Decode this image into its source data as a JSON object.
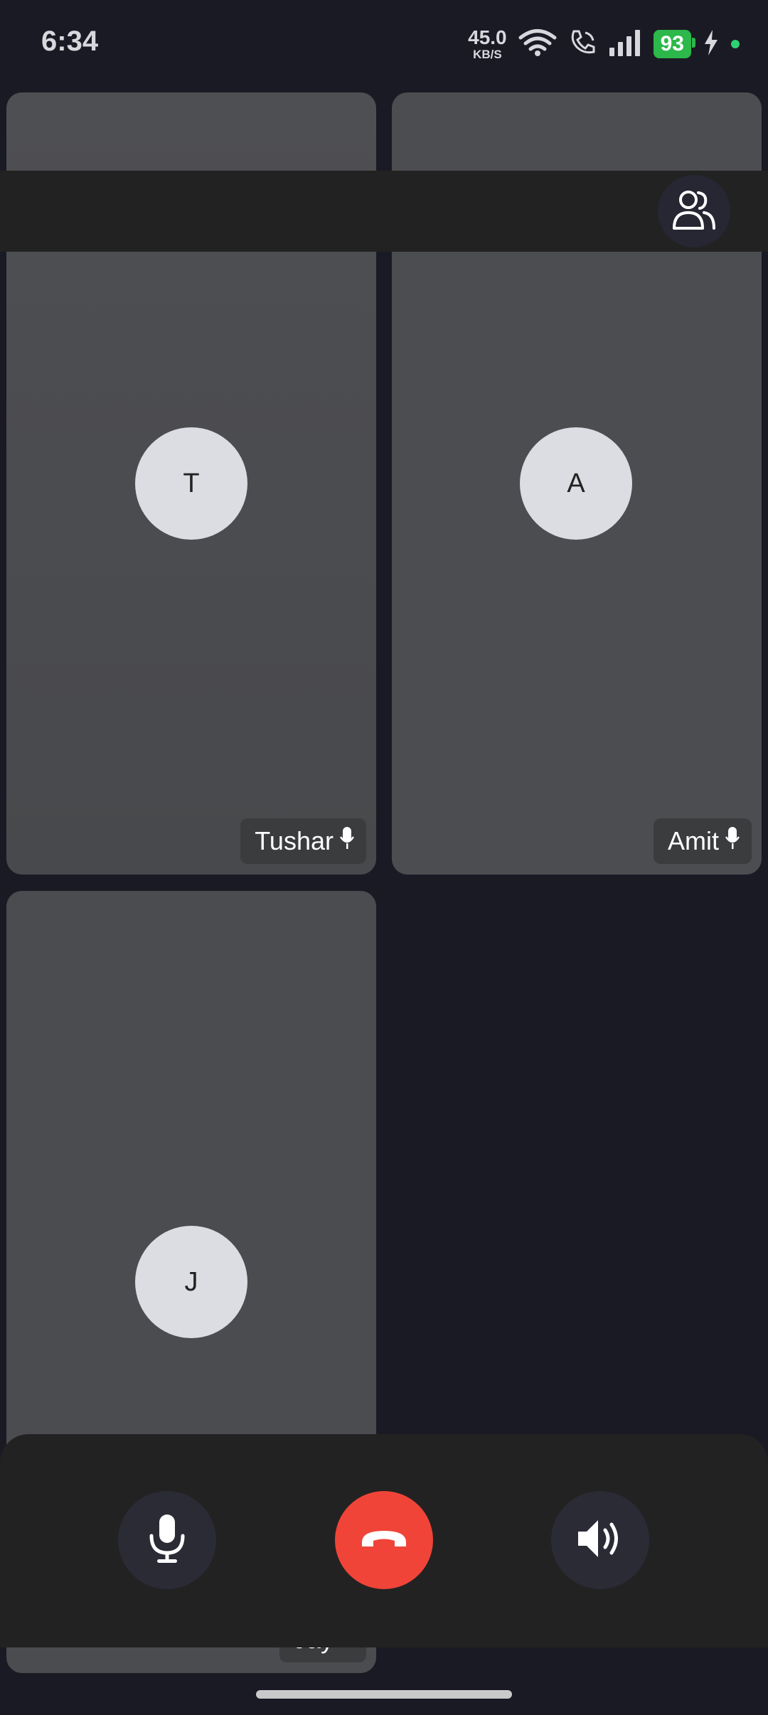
{
  "status_bar": {
    "time": "6:34",
    "net_speed_value": "45.0",
    "net_speed_unit": "KB/S",
    "battery_level": "93",
    "battery_color": "#2cb84a",
    "icons": [
      "wifi-icon",
      "wifi-call-icon",
      "signal-icon",
      "battery-icon",
      "charging-icon",
      "active-dot"
    ]
  },
  "participants": [
    {
      "initial": "T",
      "name": "Tushar",
      "mic": "mic-icon"
    },
    {
      "initial": "A",
      "name": "Amit",
      "mic": "mic-icon"
    },
    {
      "initial": "J",
      "name": "Jay",
      "mic": "mic-icon"
    }
  ],
  "top_bar": {
    "participants_button_icon": "participants-icon"
  },
  "controls": {
    "mic_icon": "mic-icon",
    "end_call_icon": "end-call-icon",
    "speaker_icon": "speaker-icon",
    "end_call_color": "#f04438"
  }
}
